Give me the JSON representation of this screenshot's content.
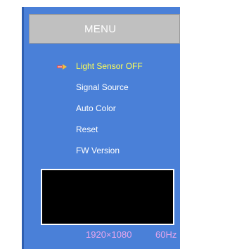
{
  "menu": {
    "title": "MENU",
    "items": [
      {
        "label": "Light Sensor OFF",
        "selected": true
      },
      {
        "label": "Signal Source",
        "selected": false
      },
      {
        "label": "Auto Color",
        "selected": false
      },
      {
        "label": "Reset",
        "selected": false
      },
      {
        "label": "FW Version",
        "selected": false
      }
    ]
  },
  "status": {
    "resolution": "1920×1080",
    "refresh_rate": "60Hz"
  },
  "icons": {
    "selection_pointer": "pointer-arrow-icon"
  },
  "colors": {
    "panel": "#4a80d8",
    "header": "#c0c0c0",
    "selected_text": "#ffff55",
    "status_text": "#e6a6ec"
  }
}
